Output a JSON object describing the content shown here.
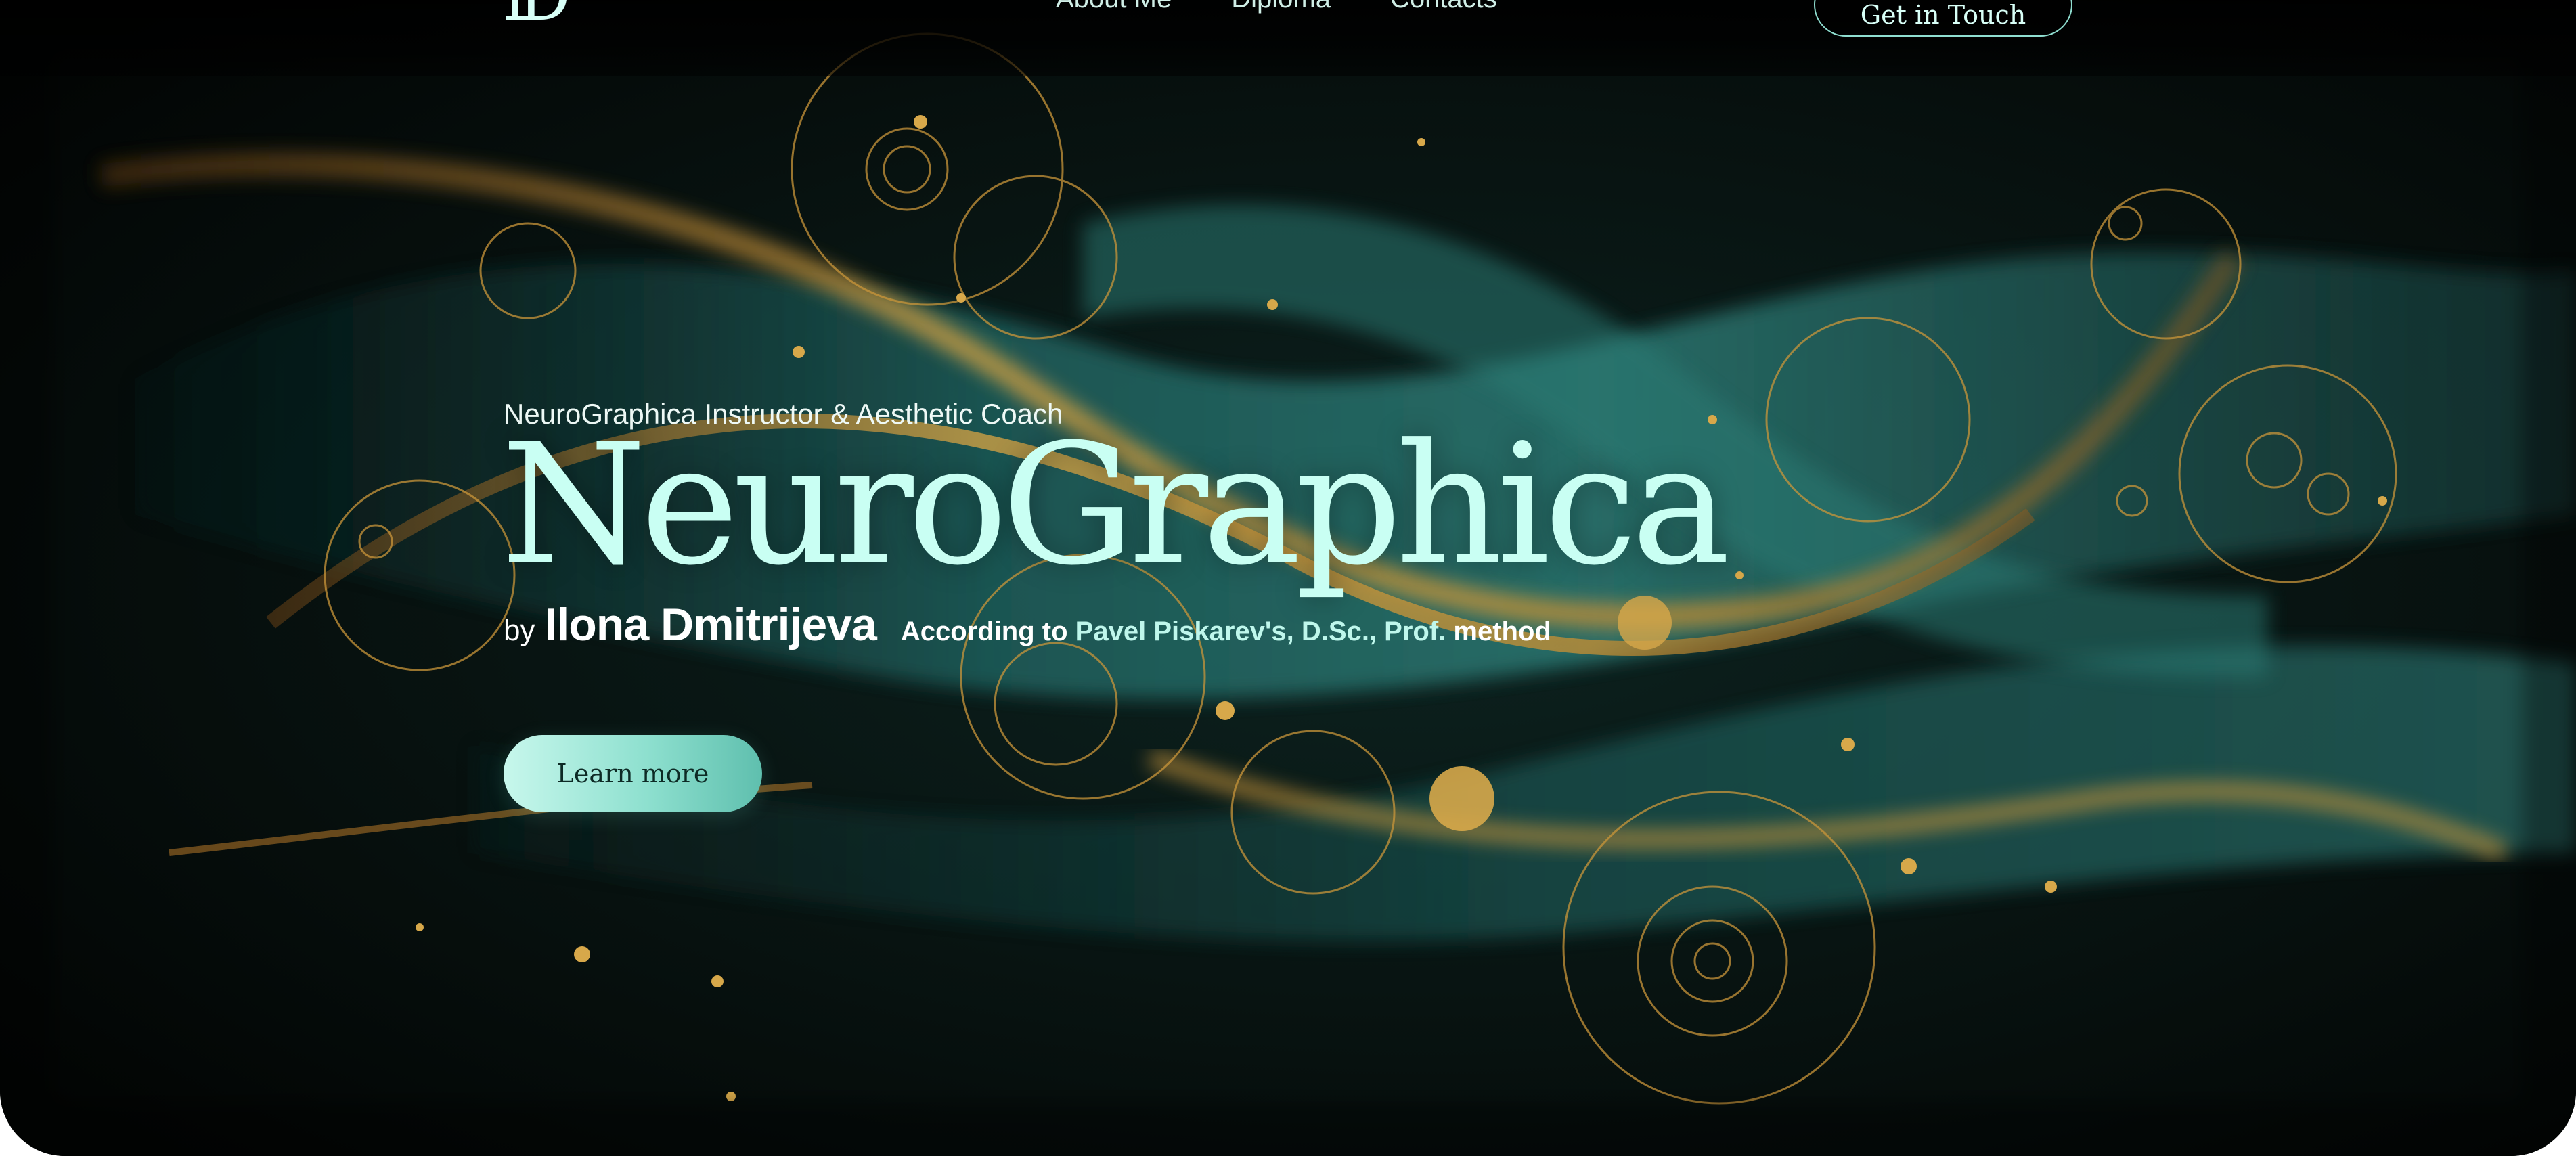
{
  "nav": {
    "logo": "ID",
    "links": [
      "About Me",
      "Diploma",
      "Contacts"
    ],
    "cta": "Get in Touch"
  },
  "hero": {
    "eyebrow": "NeuroGraphica Instructor & Aesthetic Coach",
    "title": "NeuroGraphica",
    "by": "by",
    "author": "Ilona Dmitrijeva",
    "method_prefix": "According to",
    "method_name": "Pavel Piskarev's, D.Sc., Prof.",
    "method_suffix": "method",
    "button": "Learn more"
  },
  "colors": {
    "background": "#040807",
    "title": "#c9fff3",
    "teal": "#2f7f76",
    "gold": "#c9953a",
    "button": "#8ee0cf"
  },
  "icons": {
    "logo": "id-monogram-icon"
  }
}
